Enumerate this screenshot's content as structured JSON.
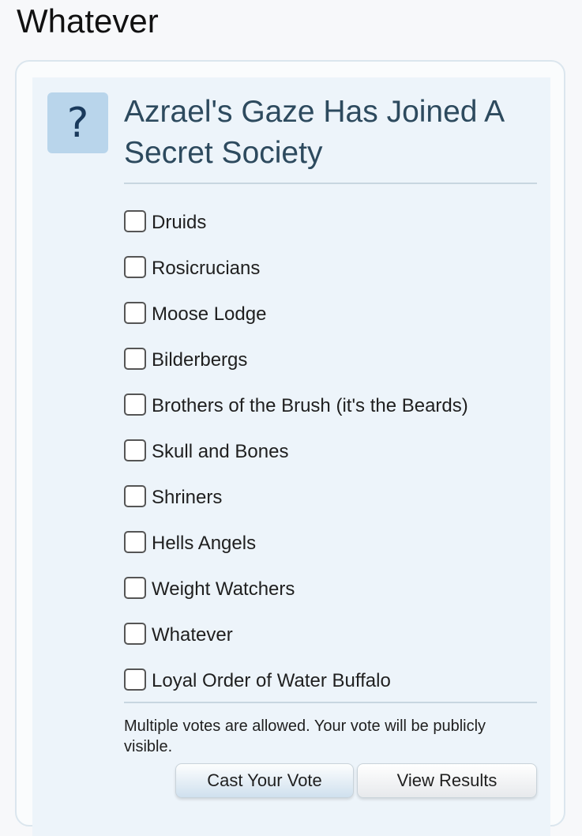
{
  "page": {
    "title": "Whatever"
  },
  "poll": {
    "icon": "question-mark-icon",
    "icon_glyph": "?",
    "title": "Azrael's Gaze Has Joined A Secret Society",
    "options": [
      {
        "label": "Druids",
        "checked": false
      },
      {
        "label": "Rosicrucians",
        "checked": false
      },
      {
        "label": "Moose Lodge",
        "checked": false
      },
      {
        "label": "Bilderbergs",
        "checked": false
      },
      {
        "label": "Brothers of the Brush (it's the Beards)",
        "checked": false
      },
      {
        "label": "Skull and Bones",
        "checked": false
      },
      {
        "label": "Shriners",
        "checked": false
      },
      {
        "label": "Hells Angels",
        "checked": false
      },
      {
        "label": "Weight Watchers",
        "checked": false
      },
      {
        "label": "Whatever",
        "checked": false
      },
      {
        "label": "Loyal Order of Water Buffalo",
        "checked": false
      }
    ],
    "note": "Multiple votes are allowed. Your vote will be publicly visible.",
    "buttons": {
      "cast_label": "Cast Your Vote",
      "view_label": "View Results"
    }
  },
  "colors": {
    "accent_badge": "#b9d5eb",
    "panel_bg": "#edf4fa",
    "title_color": "#2d4a5e"
  }
}
